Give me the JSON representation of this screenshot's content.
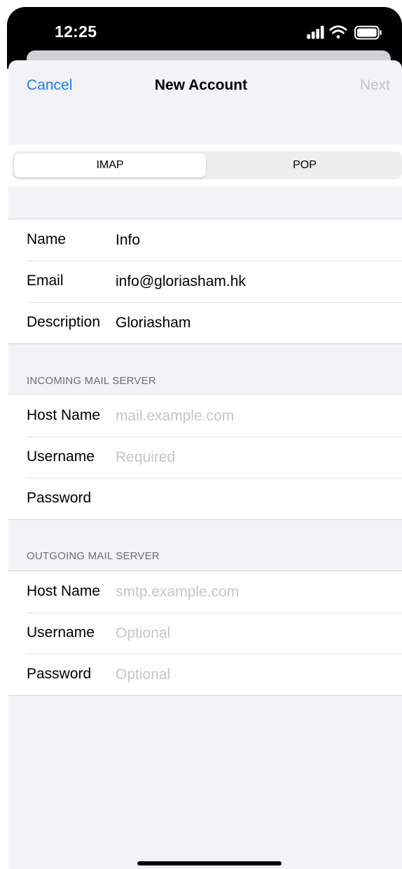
{
  "status_bar": {
    "time": "12:25",
    "icons": [
      "signal-icon",
      "wifi-icon",
      "battery-icon"
    ]
  },
  "nav": {
    "cancel_label": "Cancel",
    "title": "New Account",
    "next_label": "Next"
  },
  "segments": {
    "options": [
      "IMAP",
      "POP"
    ],
    "selected": "IMAP"
  },
  "account": {
    "name": {
      "label": "Name",
      "value": "Info"
    },
    "email": {
      "label": "Email",
      "value": "info@gloriasham.hk"
    },
    "description": {
      "label": "Description",
      "value": "Gloriasham"
    }
  },
  "incoming": {
    "header": "INCOMING MAIL SERVER",
    "host": {
      "label": "Host Name",
      "placeholder": "mail.example.com"
    },
    "username": {
      "label": "Username",
      "placeholder": "Required"
    },
    "password": {
      "label": "Password",
      "placeholder": ""
    }
  },
  "outgoing": {
    "header": "OUTGOING MAIL SERVER",
    "host": {
      "label": "Host Name",
      "placeholder": "smtp.example.com"
    },
    "username": {
      "label": "Username",
      "placeholder": "Optional"
    },
    "password": {
      "label": "Password",
      "placeholder": "Optional"
    }
  },
  "colors": {
    "accent": "#1a7cf5",
    "disabled": "#c4c4c6",
    "grouped_background": "#f2f2f7",
    "placeholder": "#c5c5c7"
  }
}
